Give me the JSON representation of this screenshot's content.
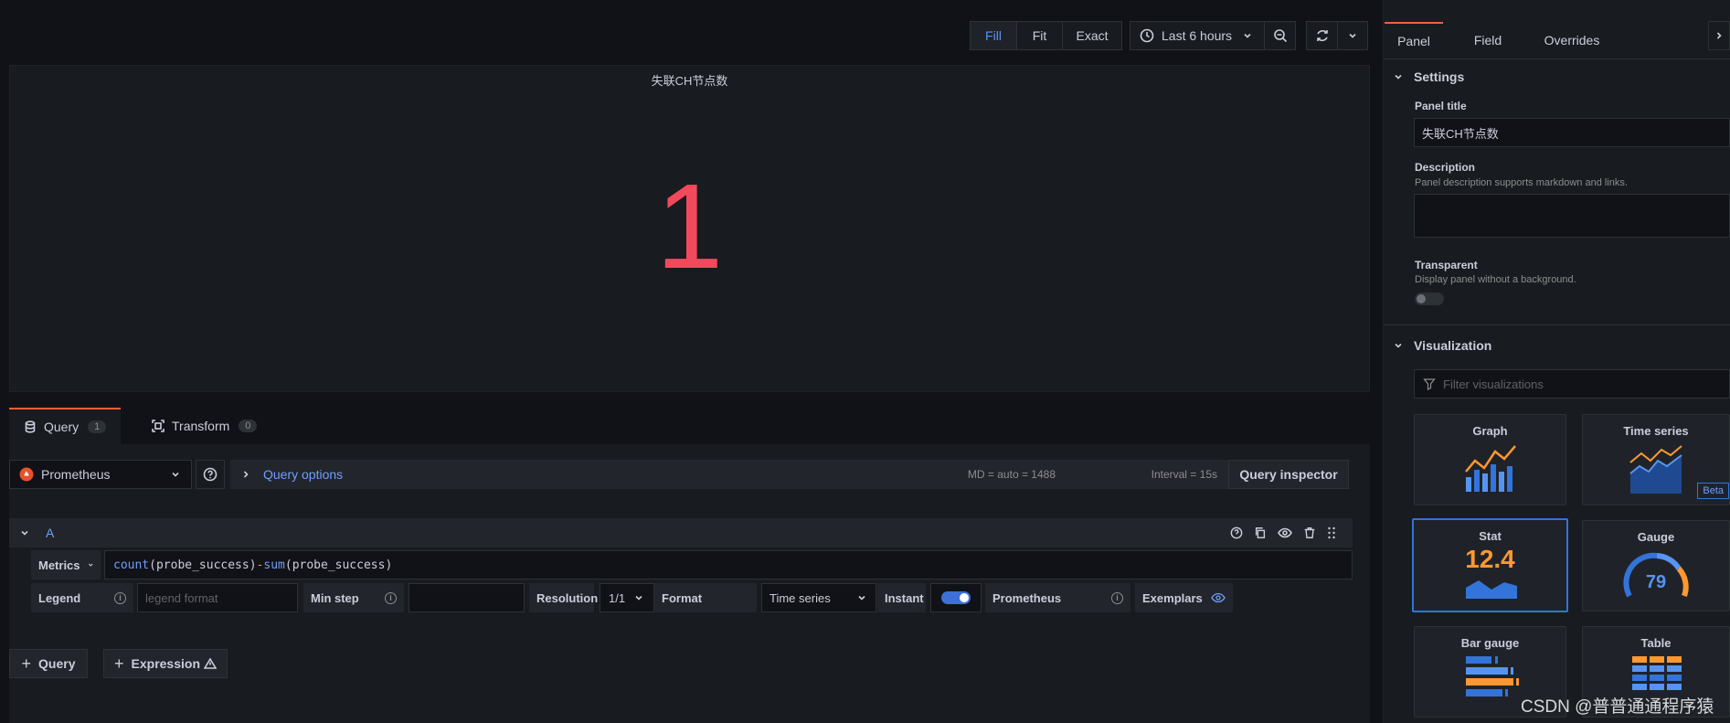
{
  "toolbar": {
    "fill": "Fill",
    "fit": "Fit",
    "exact": "Exact",
    "time_range": "Last 6 hours"
  },
  "panel": {
    "title": "失联CH节点数",
    "value": "1"
  },
  "query_tabs": {
    "query_label": "Query",
    "query_count": "1",
    "transform_label": "Transform",
    "transform_count": "0"
  },
  "query_bar": {
    "datasource": "Prometheus",
    "options_label": "Query options",
    "md": "MD = auto = 1488",
    "interval": "Interval = 15s",
    "inspector": "Query inspector"
  },
  "query_a": {
    "ref": "A",
    "metrics_label": "Metrics",
    "expr_fn1": "count",
    "expr_arg1": "probe_success",
    "expr_op": "-",
    "expr_fn2": "sum",
    "expr_arg2": "probe_success",
    "legend_label": "Legend",
    "legend_placeholder": "legend format",
    "min_step_label": "Min step",
    "resolution_label": "Resolution",
    "resolution_value": "1/1",
    "format_label": "Format",
    "format_value": "Time series",
    "instant_label": "Instant",
    "instant_on": true,
    "prometheus_label": "Prometheus",
    "exemplars_label": "Exemplars"
  },
  "add_buttons": {
    "query": "Query",
    "expression": "Expression"
  },
  "side": {
    "tabs": [
      "Panel",
      "Field",
      "Overrides"
    ],
    "settings_header": "Settings",
    "panel_title_label": "Panel title",
    "panel_title_value": "失联CH节点数",
    "description_label": "Description",
    "description_help": "Panel description supports markdown and links.",
    "transparent_label": "Transparent",
    "transparent_help": "Display panel without a background.",
    "visualization_header": "Visualization",
    "filter_placeholder": "Filter visualizations",
    "viz": {
      "graph": "Graph",
      "time_series": "Time series",
      "beta": "Beta",
      "stat": "Stat",
      "stat_value": "12.4",
      "gauge": "Gauge",
      "gauge_value": "79",
      "bar_gauge": "Bar gauge",
      "table": "Table"
    }
  },
  "watermark": "CSDN @普普通通程序猿",
  "colors": {
    "background": "#111217",
    "accent_blue": "#5794f2",
    "value_red": "#f2495c",
    "stat_orange": "#ff9830"
  }
}
